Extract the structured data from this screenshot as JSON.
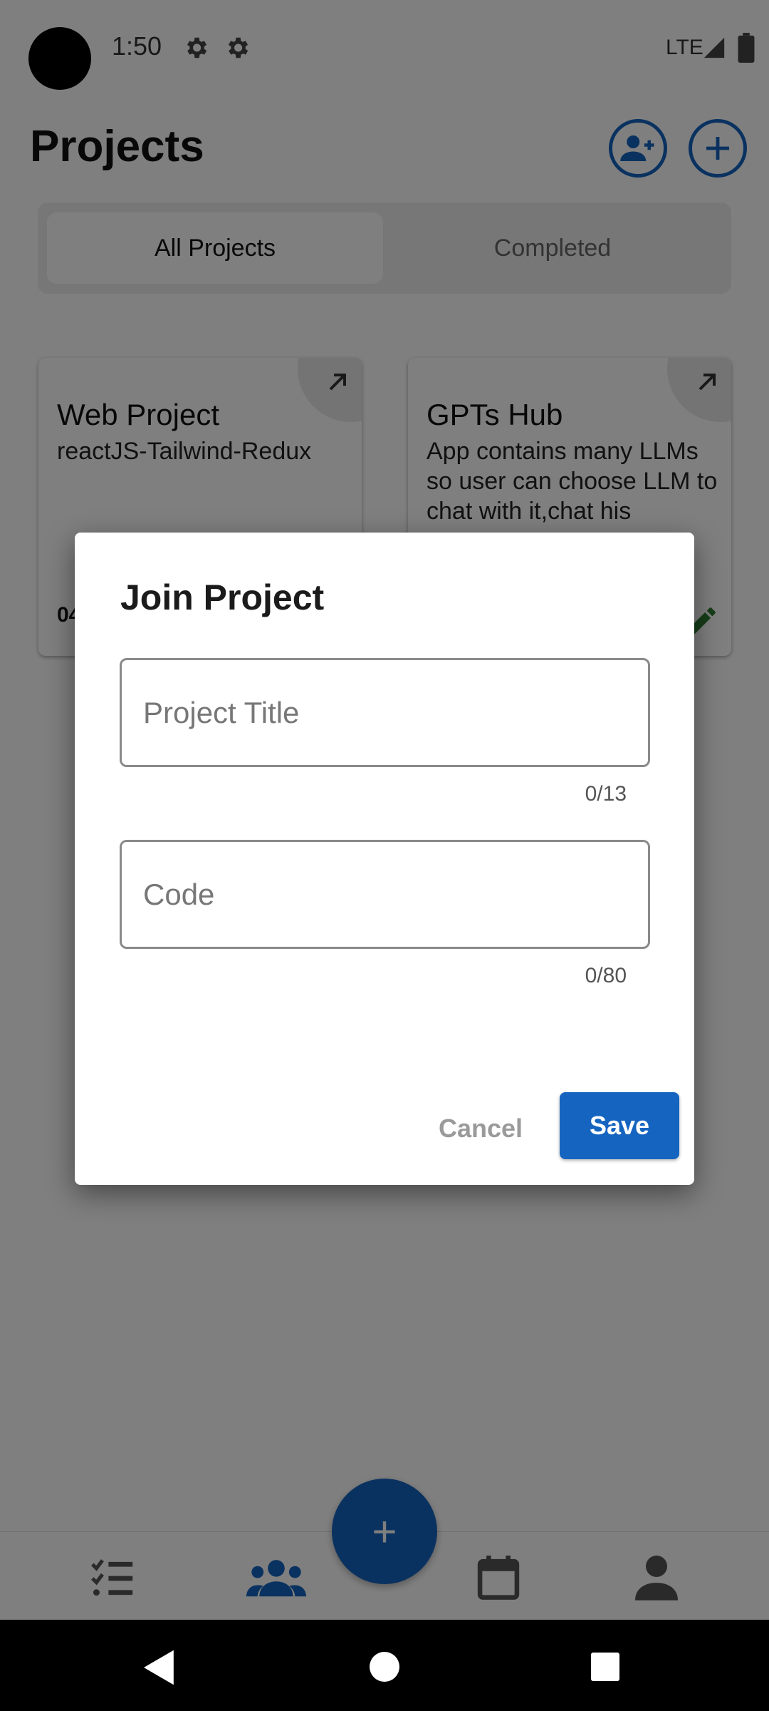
{
  "status_bar": {
    "time": "1:50",
    "network": "LTE",
    "icons": [
      "settings-icon",
      "settings-icon",
      "signal-icon",
      "battery-icon"
    ]
  },
  "header": {
    "title": "Projects",
    "join_icon": "add-group-icon",
    "add_icon": "plus-icon"
  },
  "tabs": [
    {
      "label": "All Projects",
      "selected": true
    },
    {
      "label": "Completed",
      "selected": false
    }
  ],
  "cards": [
    {
      "title": "Web Project",
      "description": "reactJS-Tailwind-Redux",
      "date_partial": "04"
    },
    {
      "title": "GPTs Hub",
      "description": "App contains many LLMs so user can choose LLM to chat with it,chat his"
    }
  ],
  "dialog": {
    "title": "Join Project",
    "fields": [
      {
        "placeholder": "Project Title",
        "value": "",
        "counter": "0/13"
      },
      {
        "placeholder": "Code",
        "value": "",
        "counter": "0/80"
      }
    ],
    "cancel_label": "Cancel",
    "save_label": "Save"
  },
  "bottom_nav": {
    "items": [
      {
        "icon": "checklist-icon",
        "active": false
      },
      {
        "icon": "people-icon",
        "active": true
      },
      {
        "icon": "calendar-icon",
        "active": false
      },
      {
        "icon": "person-icon",
        "active": false
      }
    ],
    "fab_label": "+"
  },
  "colors": {
    "primary": "#1565c0",
    "edit_green": "#2e7d32",
    "scrim": "rgba(0,0,0,0.5)"
  }
}
